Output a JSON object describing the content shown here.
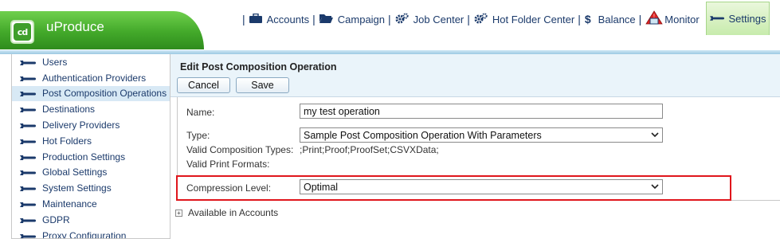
{
  "app": {
    "name": "uProduce",
    "logo_text": "cd"
  },
  "topnav": [
    {
      "label": "Accounts",
      "icon": "briefcase-icon"
    },
    {
      "label": "Campaign",
      "icon": "folder-open-icon"
    },
    {
      "label": "Job Center",
      "icon": "gears-icon"
    },
    {
      "label": "Hot Folder Center",
      "icon": "gears-icon"
    },
    {
      "label": "Balance",
      "icon": "dollar-icon"
    },
    {
      "label": "Monitor",
      "icon": "monitor-icon"
    }
  ],
  "settings_tab": {
    "label": "Settings",
    "icon": "wrench-icon"
  },
  "sidebar": {
    "items": [
      {
        "label": "Users"
      },
      {
        "label": "Authentication Providers"
      },
      {
        "label": "Post Composition Operations",
        "active": true
      },
      {
        "label": "Destinations"
      },
      {
        "label": "Delivery Providers"
      },
      {
        "label": "Hot Folders"
      },
      {
        "label": "Production Settings"
      },
      {
        "label": "Global Settings"
      },
      {
        "label": "System Settings"
      },
      {
        "label": "Maintenance"
      },
      {
        "label": "GDPR"
      },
      {
        "label": "Proxy Configuration"
      }
    ]
  },
  "content": {
    "title": "Edit Post Composition Operation",
    "cancel_label": "Cancel",
    "save_label": "Save",
    "name_label": "Name:",
    "name_value": "my test operation",
    "type_label": "Type:",
    "type_value": "Sample Post Composition Operation With Parameters",
    "valid_composition_label": "Valid Composition Types:",
    "valid_composition_value": ";Print;Proof;ProofSet;CSVXData;",
    "valid_print_label": "Valid Print Formats:",
    "compression_label": "Compression Level:",
    "compression_value": "Optimal",
    "accounts_label": "Available in Accounts",
    "accounts_toggle": "+"
  },
  "colors": {
    "nav_text": "#1b3a6b",
    "brand_green": "#43a92a",
    "highlight_red": "#e0161c",
    "active_row": "#d8e9f5"
  }
}
